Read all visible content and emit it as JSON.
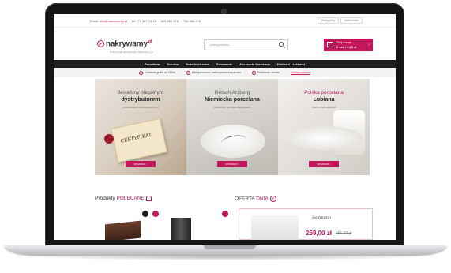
{
  "topbar": {
    "email_label": "Email:",
    "email": "info@nakrywamy.pl",
    "phone_label": "tel.:",
    "phone": "71 367 19 11",
    "phone2": "600 884 376",
    "phone3": "756 884 376",
    "login": "Zaloguj się",
    "register": "Załóż konto"
  },
  "header": {
    "logo_text": "nakrywamy",
    "logo_suffix": ".pl",
    "tagline": "Dobrze nakryte naczynia • Nakrywamy.pl",
    "search_placeholder": "Szukaj produktu",
    "cart_line1": "Twój koszyk",
    "cart_line2": "0 szt. / 0,00 zł"
  },
  "nav": [
    "Porcelana",
    "Sztućce",
    "Noże kuchenne",
    "Gotowanie",
    "Akcesoria kuchenne",
    "Kieliszki i szklanki"
  ],
  "features": {
    "shipping": "Dostawa gratis od 200zł",
    "packing": "Ubezpieczona i zabezpieczona paczka",
    "returns": "Możliwość zwrotu",
    "link": "zobacz warunki"
  },
  "banners": [
    {
      "line1": "Jesteśmy oficjalnym",
      "line2": "dystrybutorem",
      "line3": "PRODUCENTÓW MARKOWYCH",
      "button": "SPRAWDŹ >",
      "cert": "CERTYFIKAT"
    },
    {
      "line1": "Retsch Arzberg",
      "line2": "Niemiecka porcelana",
      "line3": "OGROMNY WYBÓR DEKORACJI",
      "button": "SPRAWDŹ >"
    },
    {
      "line1": "Polska porcelana",
      "line2": "Lubiana",
      "line3": "NAJWYŻSZA JAKOŚĆ",
      "button": "SPRAWDŹ >"
    }
  ],
  "sections": {
    "products_a": "Produkty",
    "products_b": "POLECANE",
    "offer_a": "OFERTA",
    "offer_b": "DNIA",
    "offer_price": "259,00 zł",
    "offer_old": "451,00 zł",
    "offer_brand": "Seltmann"
  },
  "colors": {
    "accent": "#c2185b",
    "nav": "#1e1e1e"
  }
}
